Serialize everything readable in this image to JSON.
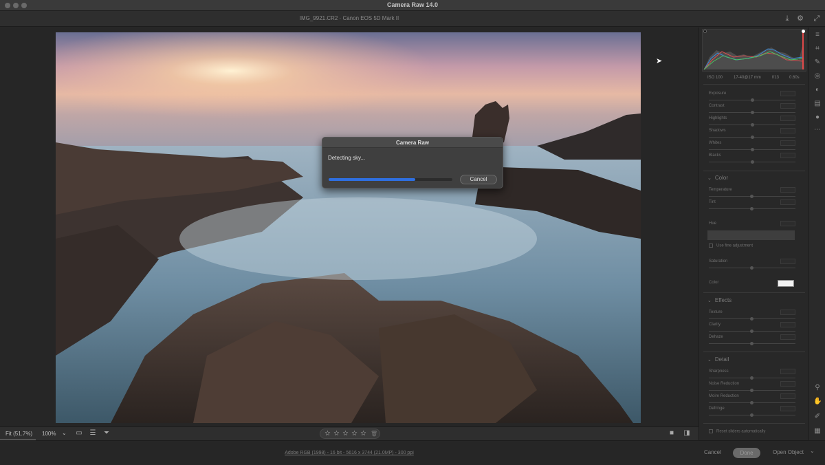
{
  "window": {
    "title": "Camera Raw 14.0"
  },
  "header": {
    "file_info": "IMG_9921.CR2  ·  Canon EOS 5D Mark II"
  },
  "dialog": {
    "title": "Camera Raw",
    "message": "Detecting sky...",
    "progress": 0.7,
    "cancel_label": "Cancel"
  },
  "toolbar": {
    "fit_label": "Fit (51.7%)",
    "zoom_label": "100%",
    "zoom_chevron": "⌄"
  },
  "rating": {
    "stars": [
      "☆",
      "☆",
      "☆",
      "☆",
      "☆"
    ],
    "trash": "🗑"
  },
  "footer": {
    "workflow_link": "Adobe RGB (1998) - 16 bit - 5616 x 3744 (21.0MP) - 300 ppi",
    "cancel_label": "Cancel",
    "done_label": "Done",
    "open_label": "Open Object",
    "open_chevron": "⌄"
  },
  "camera_info": {
    "iso": "ISO 100",
    "lens": "17-40@17 mm",
    "aperture": "f/13",
    "shutter": "0.60s"
  },
  "panel": {
    "light_sliders": [
      {
        "label": "Exposure",
        "pos": 0.5
      },
      {
        "label": "Contrast",
        "pos": 0.5
      },
      {
        "label": "Highlights",
        "pos": 0.5
      },
      {
        "label": "Shadows",
        "pos": 0.5
      },
      {
        "label": "Whites",
        "pos": 0.5
      },
      {
        "label": "Blacks",
        "pos": 0.5
      }
    ],
    "color": {
      "title": "Color",
      "temperature": "Temperature",
      "tint": "Tint",
      "hue": "Hue",
      "fine_adjust": "Use fine adjustment",
      "saturation": "Saturation",
      "color_label": "Color"
    },
    "effects": {
      "title": "Effects",
      "texture": "Texture",
      "clarity": "Clarity",
      "dehaze": "Dehaze"
    },
    "detail": {
      "title": "Detail",
      "sharpness": "Sharpness",
      "noise": "Noise Reduction",
      "moire": "Moire Reduction",
      "defringe": "Defringe"
    },
    "reset": "Reset sliders automatically"
  },
  "icons": {
    "save": "⤓",
    "gear": "⚙",
    "expand": "⤢",
    "edit": "≡",
    "crop": "⌗",
    "heal": "✎",
    "redeye": "◎",
    "mask": "◐",
    "snapshot": "▤",
    "presets": "●",
    "more": "⋯",
    "zoom": "⚲",
    "hand": "✋",
    "sampler": "✐",
    "grid": "▦",
    "filmstrip": "▭",
    "sort": "☰",
    "filter": "⏷",
    "view": "■",
    "compare": "◨",
    "chevron": "⌄"
  },
  "colors": {
    "progress": "#2f6fe0",
    "background": "#262626",
    "panel": "#282828"
  }
}
